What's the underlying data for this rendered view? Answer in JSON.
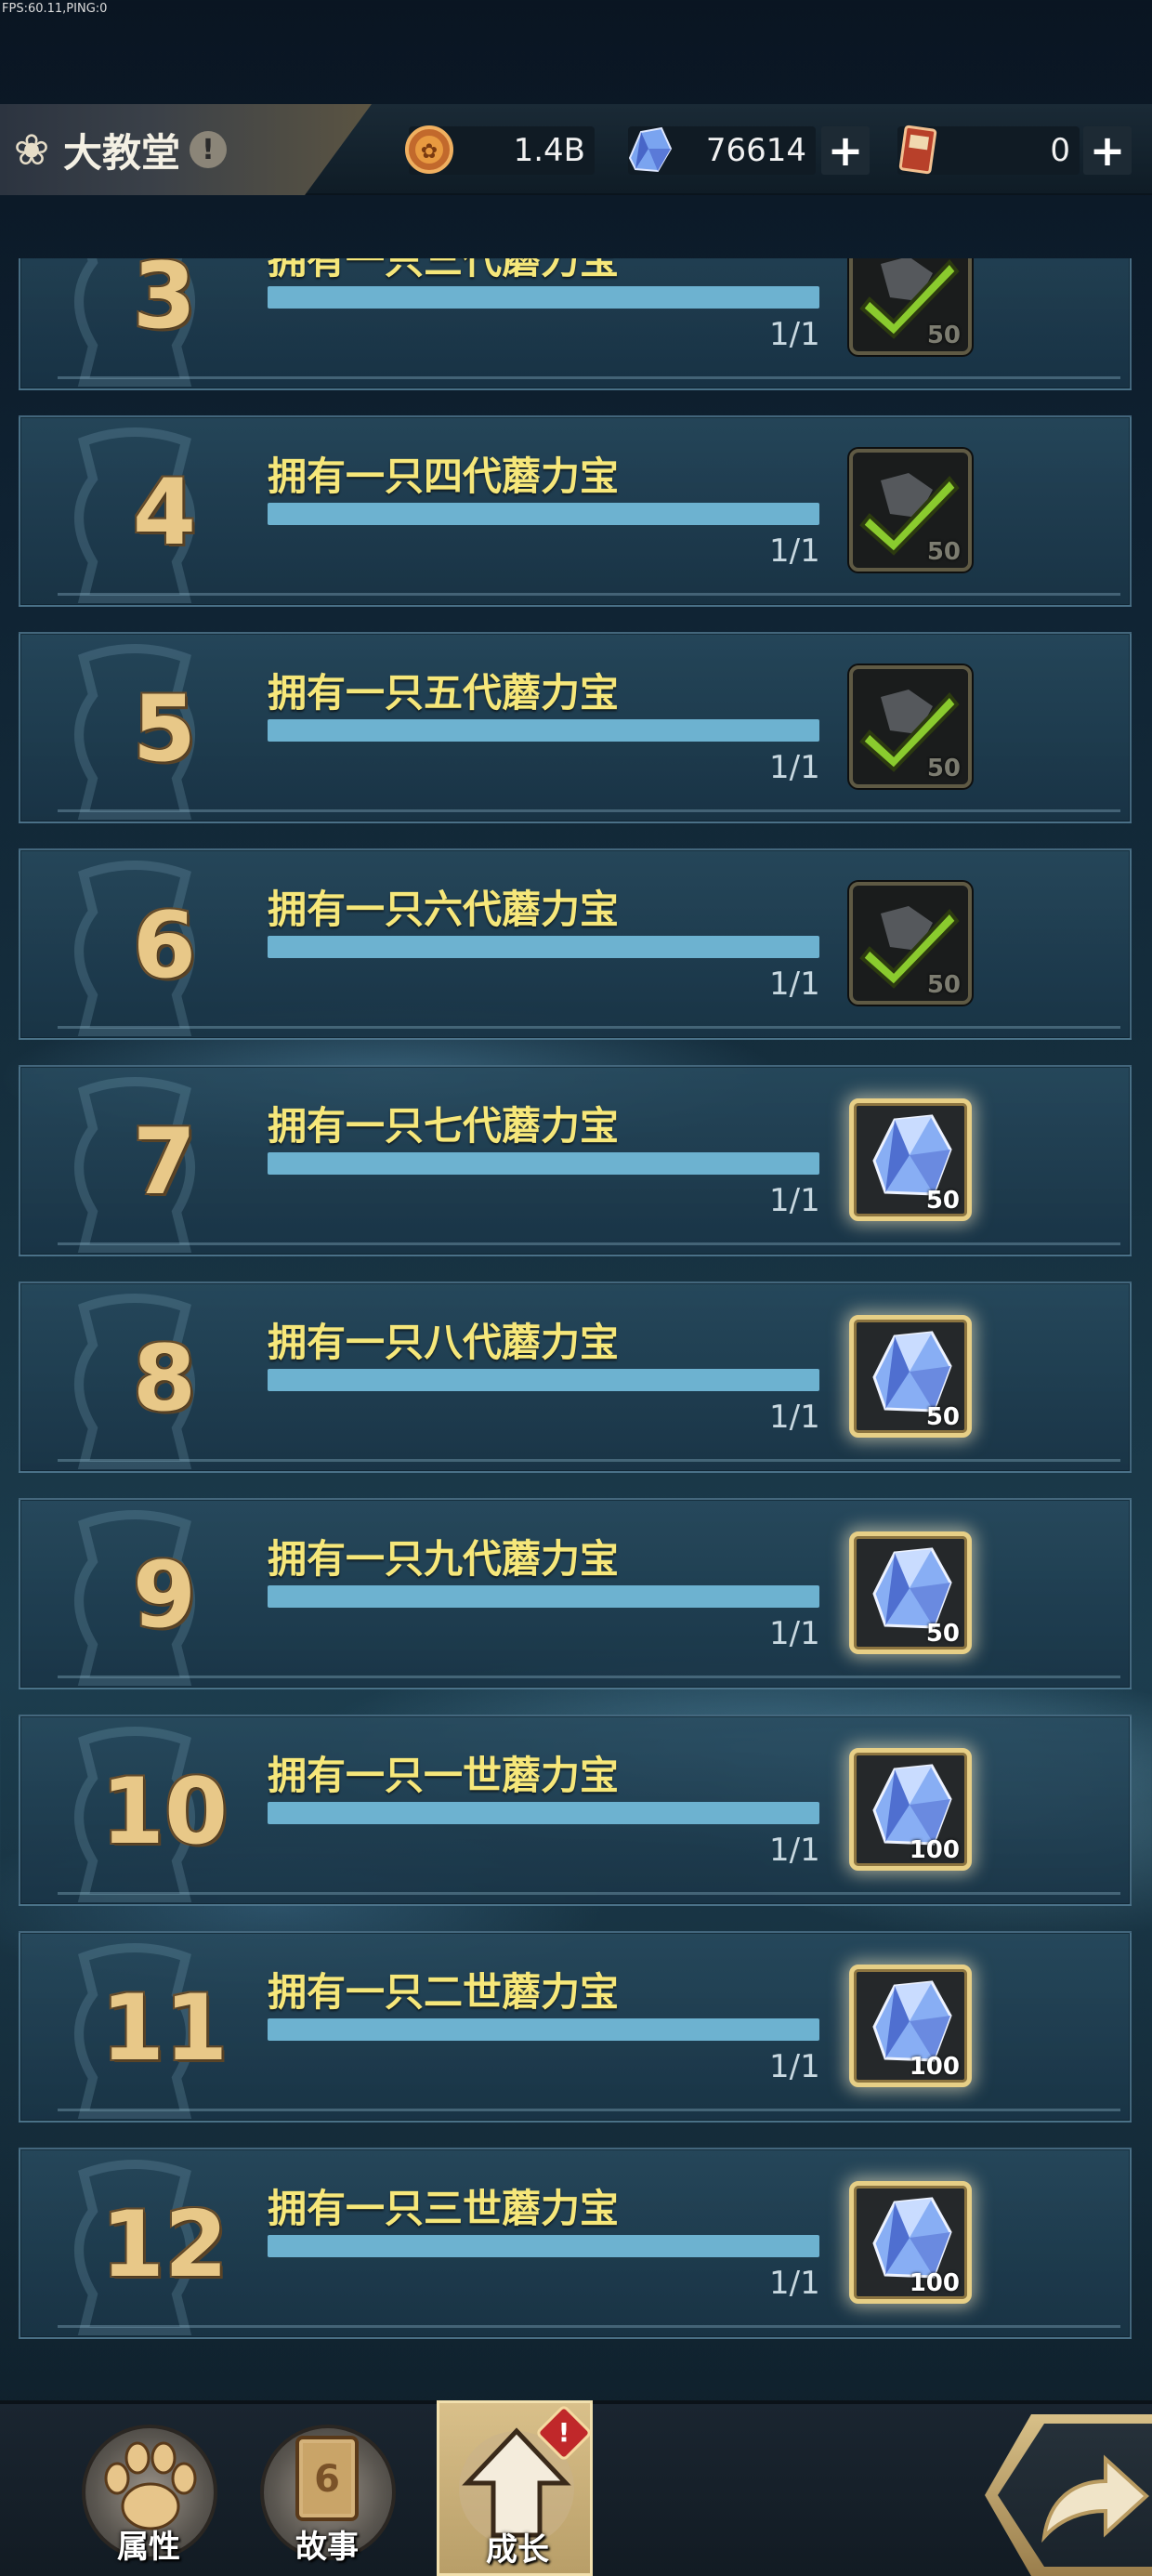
{
  "debug": {
    "fps_text": "FPS:60.11,PING:0"
  },
  "header": {
    "location_title": "大教堂",
    "location_icon": "flower-icon",
    "alert_icon": "!",
    "gold": {
      "icon": "coin-icon",
      "value": "1.4B"
    },
    "crystal": {
      "icon": "crystal-icon",
      "value": "76614"
    },
    "ticket": {
      "icon": "ticket-icon",
      "value": "0"
    },
    "plus_label": "+"
  },
  "tasks": [
    {
      "index": "3",
      "title": "拥有一只三代蘑力宝",
      "progress": "1/1",
      "progress_fraction": 1.0,
      "reward_qty": "50",
      "status": "claimed"
    },
    {
      "index": "4",
      "title": "拥有一只四代蘑力宝",
      "progress": "1/1",
      "progress_fraction": 1.0,
      "reward_qty": "50",
      "status": "claimed"
    },
    {
      "index": "5",
      "title": "拥有一只五代蘑力宝",
      "progress": "1/1",
      "progress_fraction": 1.0,
      "reward_qty": "50",
      "status": "claimed"
    },
    {
      "index": "6",
      "title": "拥有一只六代蘑力宝",
      "progress": "1/1",
      "progress_fraction": 1.0,
      "reward_qty": "50",
      "status": "claimed"
    },
    {
      "index": "7",
      "title": "拥有一只七代蘑力宝",
      "progress": "1/1",
      "progress_fraction": 1.0,
      "reward_qty": "50",
      "status": "claimable"
    },
    {
      "index": "8",
      "title": "拥有一只八代蘑力宝",
      "progress": "1/1",
      "progress_fraction": 1.0,
      "reward_qty": "50",
      "status": "claimable"
    },
    {
      "index": "9",
      "title": "拥有一只九代蘑力宝",
      "progress": "1/1",
      "progress_fraction": 1.0,
      "reward_qty": "50",
      "status": "claimable"
    },
    {
      "index": "10",
      "title": "拥有一只一世蘑力宝",
      "progress": "1/1",
      "progress_fraction": 1.0,
      "reward_qty": "100",
      "status": "claimable"
    },
    {
      "index": "11",
      "title": "拥有一只二世蘑力宝",
      "progress": "1/1",
      "progress_fraction": 1.0,
      "reward_qty": "100",
      "status": "claimable"
    },
    {
      "index": "12",
      "title": "拥有一只三世蘑力宝",
      "progress": "1/1",
      "progress_fraction": 1.0,
      "reward_qty": "100",
      "status": "claimable"
    }
  ],
  "nav": {
    "attributes": {
      "label": "属性",
      "icon": "paw-icon"
    },
    "story": {
      "label": "故事",
      "icon": "book-icon"
    },
    "growth": {
      "label": "成长",
      "icon": "arrow-up-icon",
      "alert": "!"
    },
    "back_icon": "back-arrow-icon"
  },
  "colors": {
    "task_title": "#f6e77a",
    "progress_bar": "#6db2d0",
    "index_gold": "#e8c888",
    "active_tab": "#d9c08a"
  }
}
